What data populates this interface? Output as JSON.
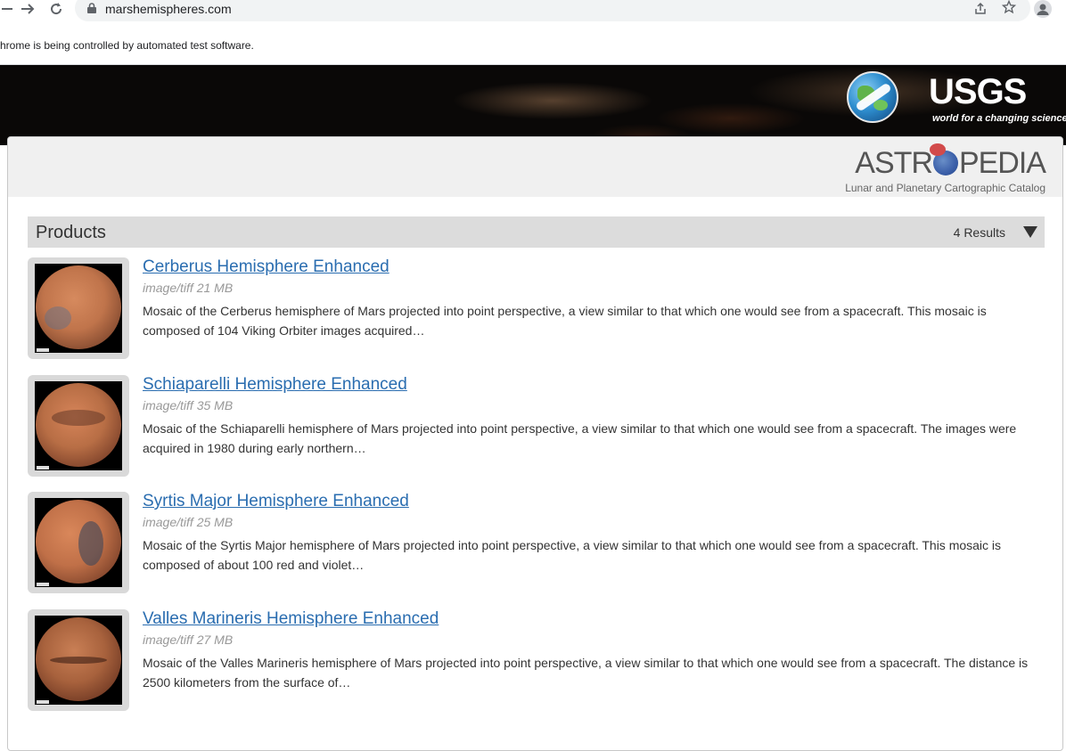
{
  "browser": {
    "url": "marshemispheres.com",
    "infobar_text": "hrome is being controlled by automated test software."
  },
  "banner": {
    "usgs_wordmark": "USGS",
    "usgs_tagline": "world for a changing science"
  },
  "header": {
    "logo_text_left": "ASTR",
    "logo_text_right": "PEDIA",
    "subtitle": "Lunar and Planetary Cartographic Catalog"
  },
  "products": {
    "title": "Products",
    "results": "4 Results",
    "items": [
      {
        "title": "Cerberus Hemisphere Enhanced",
        "meta": "image/tiff 21 MB",
        "description": "Mosaic of the Cerberus hemisphere of Mars projected into point perspective, a view similar to that which one would see from a spacecraft. This mosaic is composed of 104 Viking Orbiter images acquired…"
      },
      {
        "title": "Schiaparelli Hemisphere Enhanced",
        "meta": "image/tiff 35 MB",
        "description": "Mosaic of the Schiaparelli hemisphere of Mars projected into point perspective, a view similar to that which one would see from a spacecraft. The images were acquired in 1980 during early northern…"
      },
      {
        "title": "Syrtis Major Hemisphere Enhanced",
        "meta": "image/tiff 25 MB",
        "description": "Mosaic of the Syrtis Major hemisphere of Mars projected into point perspective, a view similar to that which one would see from a spacecraft. This mosaic is composed of about 100 red and violet…"
      },
      {
        "title": "Valles Marineris Hemisphere Enhanced",
        "meta": "image/tiff 27 MB",
        "description": "Mosaic of the Valles Marineris hemisphere of Mars projected into point perspective, a view similar to that which one would see from a spacecraft. The distance is 2500 kilometers from the surface of…"
      }
    ]
  },
  "icons": {
    "back": "arrow-left-icon",
    "forward": "arrow-right-icon",
    "reload": "reload-icon",
    "lock": "lock-icon",
    "share": "share-icon",
    "bookmark": "star-icon",
    "profile": "profile-icon",
    "dropdown": "triangle-down-icon"
  },
  "colors": {
    "link": "#2a6db0",
    "products_bar": "#dcdcdc",
    "header_bg": "#f0f0f0"
  }
}
